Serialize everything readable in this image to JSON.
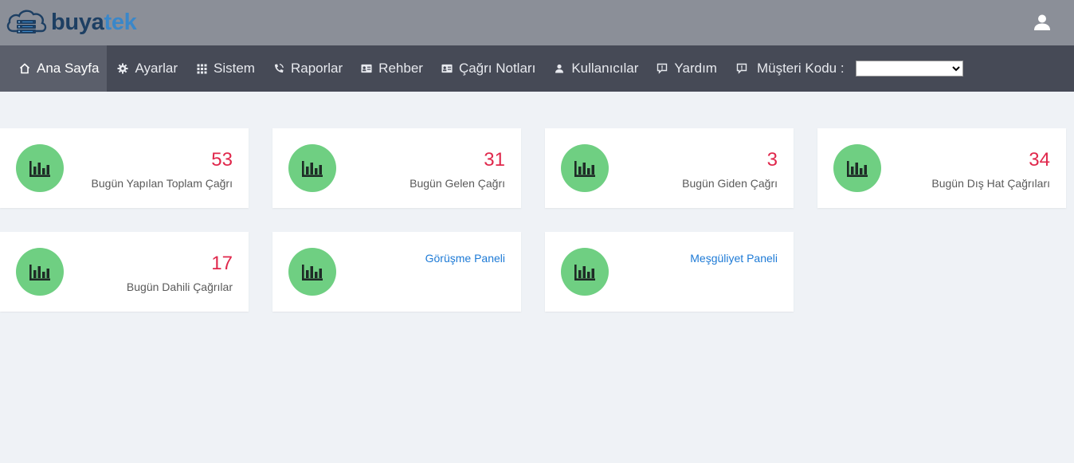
{
  "header": {
    "logo_text_part1": "buya",
    "logo_text_part2": "tek",
    "user_icon": "user-icon",
    "brand_colors": {
      "dark": "#1d3f63",
      "light": "#3a87c9"
    }
  },
  "nav": {
    "items": [
      {
        "label": "Ana Sayfa",
        "icon": "home-icon",
        "active": true
      },
      {
        "label": "Ayarlar",
        "icon": "gear-icon"
      },
      {
        "label": "Sistem",
        "icon": "grid-icon"
      },
      {
        "label": "Raporlar",
        "icon": "phone-icon"
      },
      {
        "label": "Rehber",
        "icon": "contact-card-icon"
      },
      {
        "label": "Çağrı Notları",
        "icon": "contact-card-icon"
      },
      {
        "label": "Kullanıcılar",
        "icon": "user-icon"
      },
      {
        "label": "Yardım",
        "icon": "chat-icon"
      }
    ],
    "customer_code_label": "Müşteri Kodu :",
    "customer_code_icon": "chat-icon",
    "customer_code_value": ""
  },
  "cards": [
    {
      "value": "53",
      "label": "Bugün Yapılan Toplam Çağrı",
      "icon": "bar-chart-icon"
    },
    {
      "value": "31",
      "label": "Bugün Gelen Çağrı",
      "icon": "bar-chart-icon"
    },
    {
      "value": "3",
      "label": "Bugün Giden Çağrı",
      "icon": "bar-chart-icon"
    },
    {
      "value": "34",
      "label": "Bugün Dış Hat Çağrıları",
      "icon": "bar-chart-icon"
    },
    {
      "value": "17",
      "label": "Bugün Dahili Çağrılar",
      "icon": "bar-chart-icon"
    },
    {
      "link": "Görüşme Paneli",
      "icon": "bar-chart-icon"
    },
    {
      "link": "Meşgüliyet Paneli",
      "icon": "bar-chart-icon"
    }
  ],
  "colors": {
    "accent_value": "#e0284c",
    "icon_circle": "#6fcf82",
    "link": "#1d7ad6",
    "navbar": "#464a56",
    "topbar": "#8b8f98"
  }
}
